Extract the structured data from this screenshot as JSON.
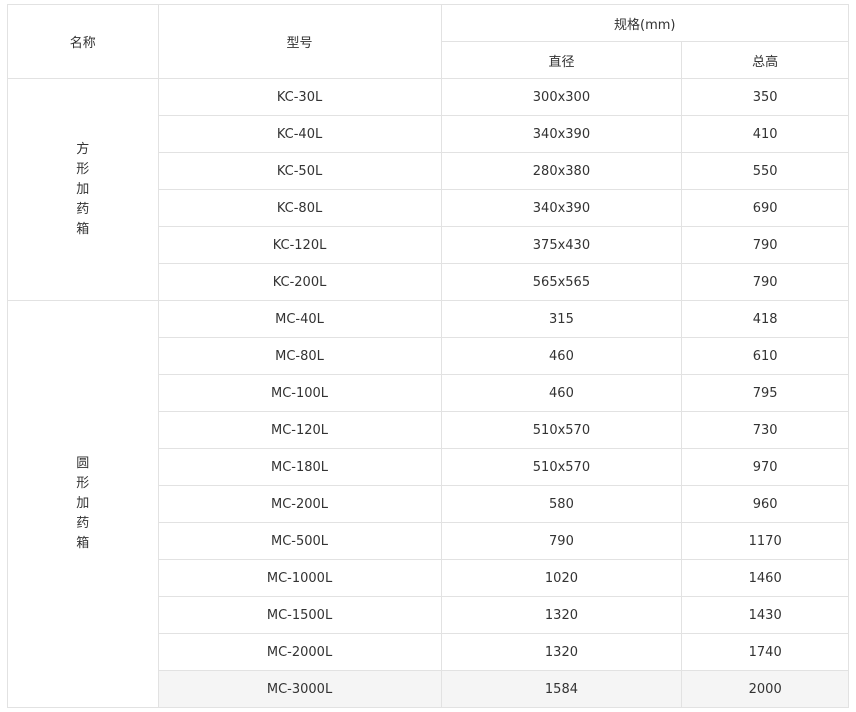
{
  "headers": {
    "name": "名称",
    "model": "型号",
    "spec": "规格(mm)",
    "diameter": "直径",
    "height": "总高"
  },
  "groups": [
    {
      "name": [
        "方",
        "形",
        "加",
        "药",
        "箱"
      ],
      "rows": [
        {
          "model": "KC-30L",
          "diameter": "300x300",
          "height": "350"
        },
        {
          "model": "KC-40L",
          "diameter": "340x390",
          "height": "410"
        },
        {
          "model": "KC-50L",
          "diameter": "280x380",
          "height": "550"
        },
        {
          "model": "KC-80L",
          "diameter": "340x390",
          "height": "690"
        },
        {
          "model": "KC-120L",
          "diameter": "375x430",
          "height": "790"
        },
        {
          "model": "KC-200L",
          "diameter": "565x565",
          "height": "790"
        }
      ]
    },
    {
      "name": [
        "圆",
        "形",
        "加",
        "药",
        "箱"
      ],
      "rows": [
        {
          "model": "MC-40L",
          "diameter": "315",
          "height": "418"
        },
        {
          "model": "MC-80L",
          "diameter": "460",
          "height": "610"
        },
        {
          "model": "MC-100L",
          "diameter": "460",
          "height": "795"
        },
        {
          "model": "MC-120L",
          "diameter": "510x570",
          "height": "730"
        },
        {
          "model": "MC-180L",
          "diameter": "510x570",
          "height": "970"
        },
        {
          "model": "MC-200L",
          "diameter": "580",
          "height": "960"
        },
        {
          "model": "MC-500L",
          "diameter": "790",
          "height": "1170"
        },
        {
          "model": "MC-1000L",
          "diameter": "1020",
          "height": "1460"
        },
        {
          "model": "MC-1500L",
          "diameter": "1320",
          "height": "1430"
        },
        {
          "model": "MC-2000L",
          "diameter": "1320",
          "height": "1740"
        },
        {
          "model": "MC-3000L",
          "diameter": "1584",
          "height": "2000"
        }
      ]
    }
  ]
}
